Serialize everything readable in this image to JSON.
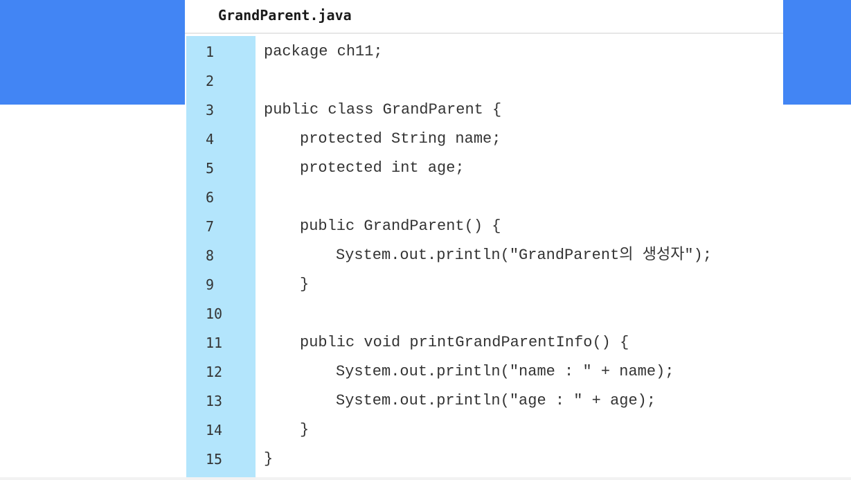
{
  "file": {
    "title": "GrandParent.java"
  },
  "colors": {
    "accent_band": "#4285f4",
    "gutter": "#b3e5fc",
    "code_text": "#333333"
  },
  "code": {
    "lines": [
      {
        "number": "1",
        "text": "package ch11;"
      },
      {
        "number": "2",
        "text": ""
      },
      {
        "number": "3",
        "text": "public class GrandParent {"
      },
      {
        "number": "4",
        "text": "protected String name;"
      },
      {
        "number": "5",
        "text": "protected int age;"
      },
      {
        "number": "6",
        "text": ""
      },
      {
        "number": "7",
        "text": "public GrandParent() {"
      },
      {
        "number": "8",
        "text": "System.out.println(\"GrandParent의 생성자\");"
      },
      {
        "number": "9",
        "text": "}"
      },
      {
        "number": "10",
        "text": ""
      },
      {
        "number": "11",
        "text": "public void printGrandParentInfo() {"
      },
      {
        "number": "12",
        "text": "System.out.println(\"name : \" + name);"
      },
      {
        "number": "13",
        "text": "System.out.println(\"age : \" + age);"
      },
      {
        "number": "14",
        "text": "}"
      },
      {
        "number": "15",
        "text": "}"
      }
    ]
  }
}
